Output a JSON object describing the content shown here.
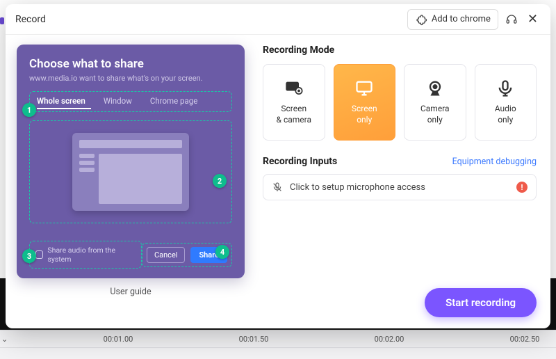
{
  "header": {
    "title": "Record",
    "add_to_chrome": "Add to chrome"
  },
  "share_dialog": {
    "title": "Choose what to share",
    "subtitle": "www.media.io want to share what's on your screen.",
    "tabs": {
      "whole": "Whole screen",
      "window": "Window",
      "page": "Chrome page"
    },
    "audio_label": "Share audio from the system",
    "cancel": "Cancel",
    "share": "Share",
    "badges": {
      "b1": "1",
      "b2": "2",
      "b3": "3",
      "b4": "4"
    }
  },
  "user_guide": "User guide",
  "modes": {
    "section": "Recording Mode",
    "screen_camera": "Screen\n& camera",
    "screen_only": "Screen\nonly",
    "camera_only": "Camera\nonly",
    "audio_only": "Audio\nonly"
  },
  "inputs": {
    "section": "Recording Inputs",
    "equip": "Equipment debugging",
    "mic": "Click to setup microphone access",
    "warn": "!"
  },
  "start": "Start recording",
  "timeline": {
    "t0": "00:01.00",
    "t1": "00:01.50",
    "t2": "00:02.00",
    "t3": "00:02.50"
  }
}
